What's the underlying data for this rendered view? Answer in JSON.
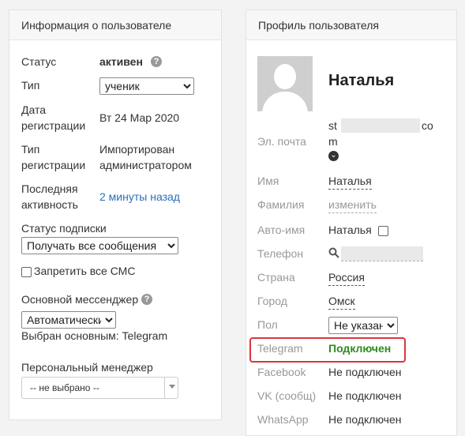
{
  "left": {
    "title": "Информация о пользователе",
    "status_label": "Статус",
    "status_value": "активен",
    "type_label": "Тип",
    "type_value": "ученик",
    "reg_date_label_1": "Дата",
    "reg_date_label_2": "регистрации",
    "reg_date_value": "Вт 24 Мар 2020",
    "reg_type_label_1": "Тип",
    "reg_type_label_2": "регистрации",
    "reg_type_value_1": "Импортирован",
    "reg_type_value_2": "администратором",
    "last_activity_label_1": "Последняя",
    "last_activity_label_2": "активность",
    "last_activity_value": "2 минуты назад",
    "subscription_label": "Статус подписки",
    "subscription_value": "Получать все сообщения",
    "sms_label": "Запретить все СМС",
    "messenger_label": "Основной мессенджер",
    "messenger_value": "Автоматически",
    "messenger_chosen": "Выбран основным: Telegram",
    "manager_label": "Персональный менеджер",
    "manager_value": "-- не выбрано --"
  },
  "right": {
    "title": "Профиль пользователя",
    "name": "Наталья",
    "email_label": "Эл. почта",
    "email_start": "st",
    "email_end": "co",
    "email_tail": "m",
    "first_name_label": "Имя",
    "first_name_value": "Наталья",
    "last_name_label": "Фамилия",
    "last_name_value": "изменить",
    "auto_name_label": "Авто-имя",
    "auto_name_value": "Наталья",
    "phone_label": "Телефон",
    "country_label": "Страна",
    "country_value": "Россия",
    "city_label": "Город",
    "city_value": "Омск",
    "gender_label": "Пол",
    "gender_value": "Не указан",
    "telegram_label": "Telegram",
    "telegram_value": "Подключен",
    "facebook_label": "Facebook",
    "facebook_value": "Не подключен",
    "vk_label": "VK (сообщ)",
    "vk_value": "Не подключен",
    "whatsapp_label": "WhatsApp",
    "whatsapp_value": "Не подключен"
  },
  "icons": {
    "help": "?",
    "expand": "⌄",
    "search": "🔍"
  },
  "colors": {
    "link": "#2a6ebb",
    "connected": "#2e8b1e",
    "highlight": "#d9363e"
  }
}
